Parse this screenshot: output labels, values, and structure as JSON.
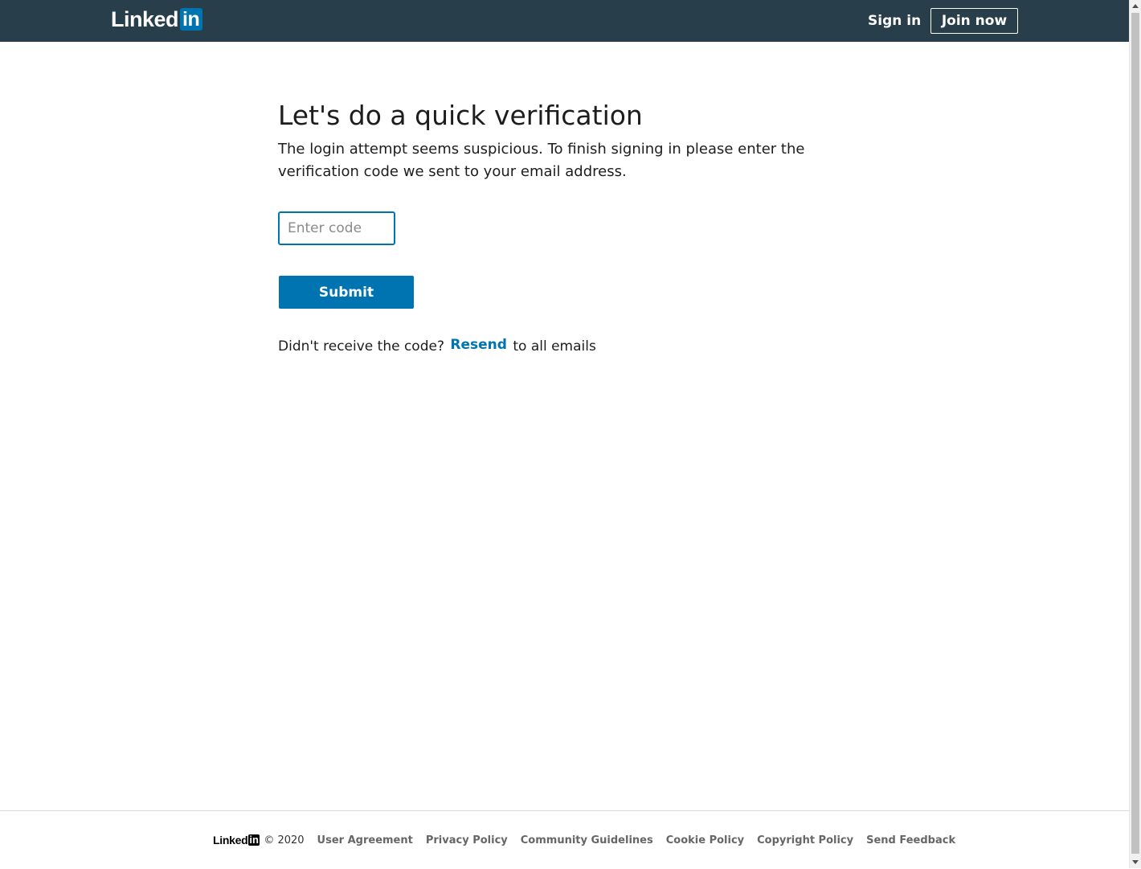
{
  "header": {
    "logo_text": "Linked",
    "logo_box": "in",
    "sign_in": "Sign in",
    "join_now": "Join now"
  },
  "main": {
    "title": "Let's do a quick verification",
    "subtitle": "The login attempt seems suspicious. To finish signing in please enter the verification code we sent to your email address.",
    "code_placeholder": "Enter code",
    "code_value": "",
    "submit_label": "Submit",
    "resend_prefix": "Didn't receive the code?",
    "resend_link": "Resend",
    "resend_suffix": "to all emails"
  },
  "footer": {
    "logo_text": "Linked",
    "logo_box": "in",
    "copyright": "© 2020",
    "links": [
      "User Agreement",
      "Privacy Policy",
      "Community Guidelines",
      "Cookie Policy",
      "Copyright Policy",
      "Send Feedback"
    ]
  },
  "colors": {
    "header_bg": "#283e4a",
    "brand_blue": "#0073b1"
  }
}
